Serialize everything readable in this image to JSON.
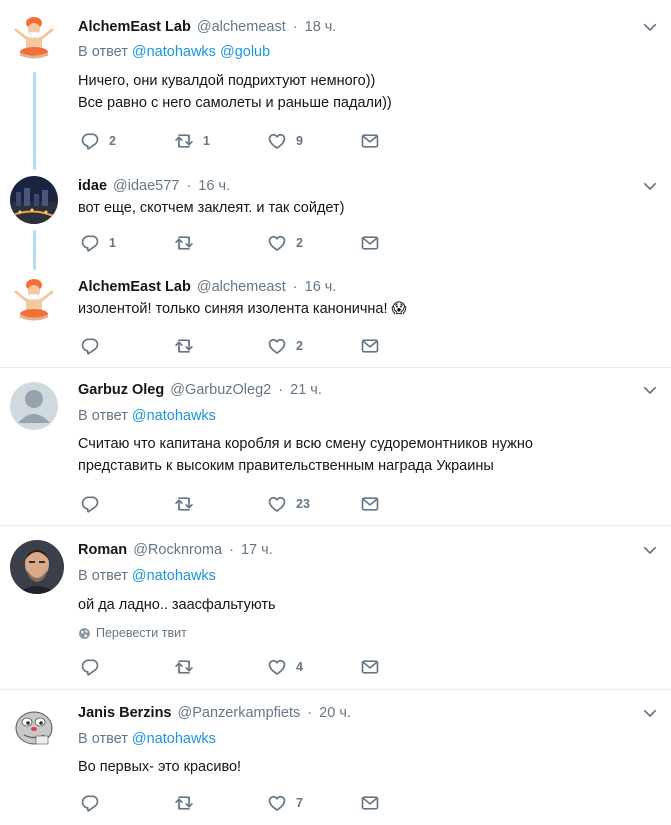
{
  "tweets": [
    {
      "name": "AlchemEast Lab",
      "handle": "@alchemeast",
      "time": "18 ч.",
      "reply_prefix": "В ответ",
      "mentions": [
        "@natohawks",
        "@golub"
      ],
      "text_lines": [
        "Ничего, они кувалдой подрихтуют немного))",
        "Все равно с него самолеты и раньше падали))"
      ],
      "replies": "2",
      "retweets": "1",
      "likes": "9"
    },
    {
      "name": "idae",
      "handle": "@idae577",
      "time": "16 ч.",
      "text_lines": [
        "вот еще, скотчем заклеят. и так сойдет)"
      ],
      "replies": "1",
      "retweets": "",
      "likes": "2"
    },
    {
      "name": "AlchemEast Lab",
      "handle": "@alchemeast",
      "time": "16 ч.",
      "text_lines": [
        "изолентой! только синяя изолента канонична!"
      ],
      "emoji": "😱",
      "replies": "",
      "retweets": "",
      "likes": "2"
    },
    {
      "name": "Garbuz Oleg",
      "handle": "@GarbuzOleg2",
      "time": "21 ч.",
      "reply_prefix": "В ответ",
      "mentions": [
        "@natohawks"
      ],
      "text_lines": [
        "Считаю что капитана коробля и всю смену судоремонтников нужно",
        "представить к высоким правительственным награда Украины"
      ],
      "replies": "",
      "retweets": "",
      "likes": "23"
    },
    {
      "name": "Roman",
      "handle": "@Rocknroma",
      "time": "17 ч.",
      "reply_prefix": "В ответ",
      "mentions": [
        "@natohawks"
      ],
      "text_lines": [
        "ой  да ладно.. заасфальтують"
      ],
      "translate": "Перевести твит",
      "replies": "",
      "retweets": "",
      "likes": "4"
    },
    {
      "name": "Janis Berzins",
      "handle": "@Panzerkampfiets",
      "time": "20 ч.",
      "reply_prefix": "В ответ",
      "mentions": [
        "@natohawks"
      ],
      "text_lines": [
        "Во первых- это красиво!"
      ],
      "replies": "",
      "retweets": "",
      "likes": "7"
    }
  ],
  "colors": {
    "accent": "#1b95e0",
    "muted": "#657786",
    "thread_line": "#b8dcf5",
    "separator": "#e6ecf0"
  },
  "icons": [
    "reply-icon",
    "retweet-icon",
    "like-icon",
    "direct-message-icon",
    "chevron-down-icon",
    "globe-icon"
  ]
}
